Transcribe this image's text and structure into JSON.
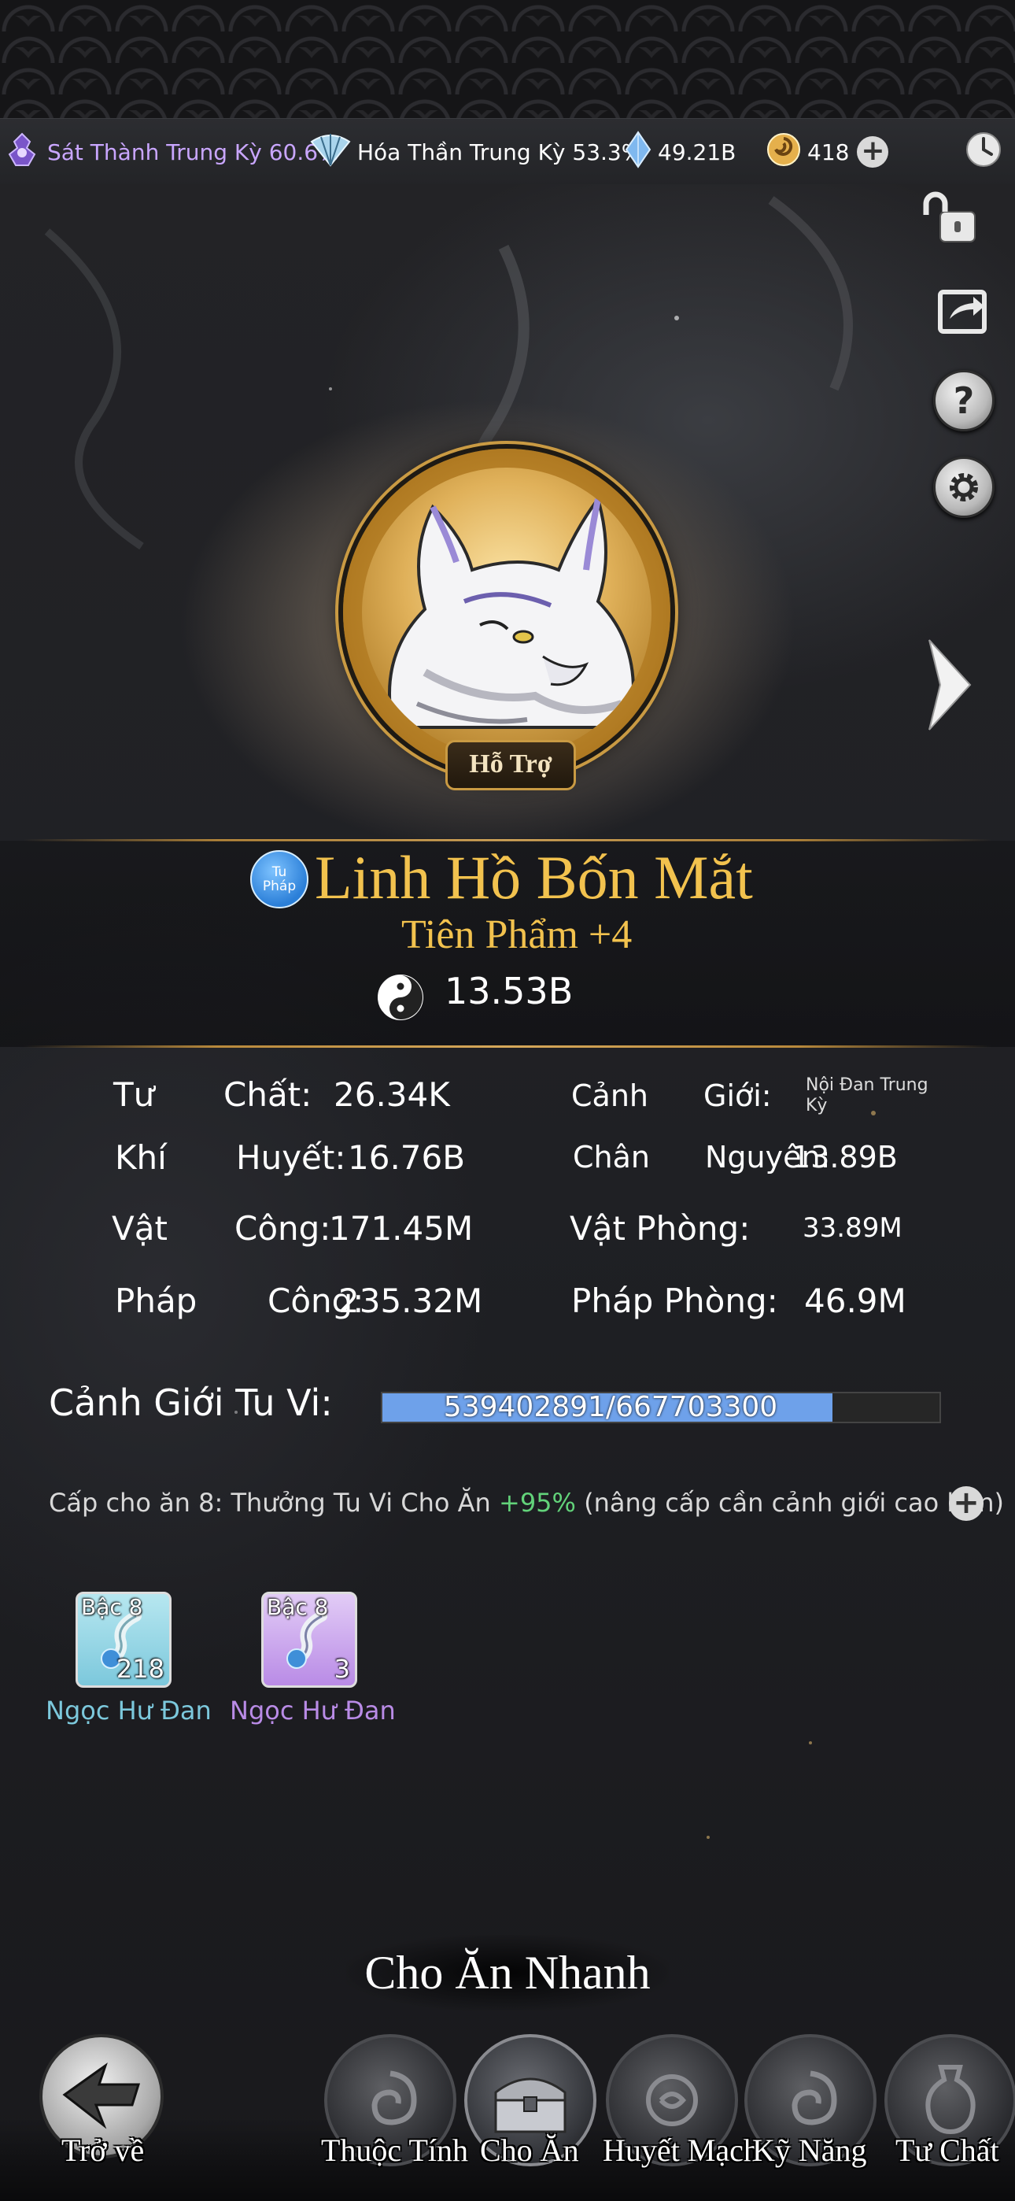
{
  "resources": {
    "realm_1": "Sát Thành Trung Kỳ 60.6%",
    "realm_2": "Hóa Thần Trung Kỳ 53.3%",
    "crystal": "49.21B",
    "coin": "418"
  },
  "pet": {
    "role": "Hỗ Trợ",
    "type_badge": "Tu Pháp",
    "name": "Linh Hồ Bốn Mắt",
    "grade": "Tiên Phẩm +4",
    "power": "13.53B"
  },
  "stats": {
    "tu_chat_label_1": "Tư",
    "tu_chat_label_2": "Chất:",
    "tu_chat_value": "26.34K",
    "khi_huyet_label_1": "Khí",
    "khi_huyet_label_2": "Huyết:",
    "khi_huyet_value": "16.76B",
    "vat_cong_label_1": "Vật",
    "vat_cong_label_2": "Công:",
    "vat_cong_value": "171.45M",
    "phap_cong_label_1": "Pháp",
    "phap_cong_label_2": "Công:",
    "phap_cong_value": "235.32M",
    "canh_gioi_label_1": "Cảnh",
    "canh_gioi_label_2": "Giới:",
    "canh_gioi_value": "Nội Đan Trung Kỳ",
    "chan_nguyen_label_1": "Chân",
    "chan_nguyen_label_2": "Nguyên:",
    "chan_nguyen_value": "13.89B",
    "vat_phong_label": "Vật Phòng:",
    "vat_phong_value": "33.89M",
    "phap_phong_label": "Pháp Phòng:",
    "phap_phong_value": "46.9M"
  },
  "cultivation": {
    "label": "Cảnh Giới Tu Vi:",
    "text": "539402891/667703300",
    "progress": 0.808
  },
  "feed": {
    "level_text_prefix": "Cấp cho ăn 8: Thưởng Tu Vi Cho Ăn ",
    "bonus": "+95%",
    "level_text_suffix": " (nâng cấp cần cảnh giới cao hơn)"
  },
  "items": [
    {
      "tier": "Bậc 8",
      "count": "218",
      "name": "Ngọc Hư Đan",
      "color": "#7cc8dc"
    },
    {
      "tier": "Bậc 8",
      "count": "3",
      "name": "Ngọc Hư Đan",
      "color": "#b98be6"
    }
  ],
  "quick_feed_label": "Cho Ăn Nhanh",
  "nav": {
    "back": "Trở về",
    "attributes": "Thuộc Tính",
    "feed": "Cho Ăn",
    "bloodline": "Huyết Mạch",
    "skills": "Kỹ Năng",
    "aptitude": "Tư Chất"
  },
  "colors": {
    "gold": "#f2c24e",
    "xp_bar": "#6ea1ea",
    "bonus_green": "#62d37a"
  }
}
